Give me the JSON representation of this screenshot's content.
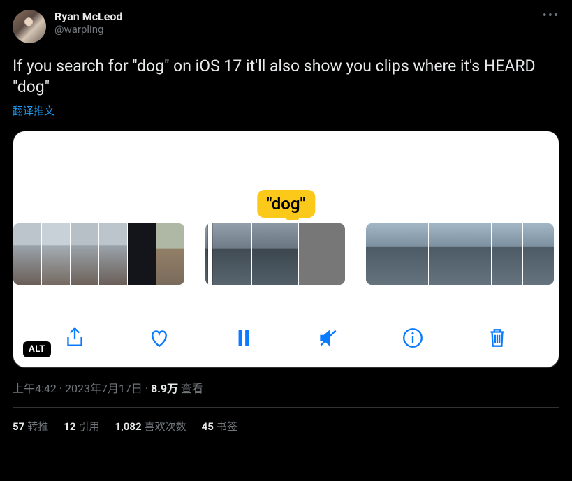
{
  "author": {
    "display_name": "Ryan McLeod",
    "handle": "@warpling"
  },
  "body": "If you search for \"dog\" on iOS 17 it'll also show you clips where it's HEARD \"dog\"",
  "translate_label": "翻译推文",
  "media": {
    "bubble": "\"dog\"",
    "alt_badge": "ALT"
  },
  "meta": {
    "time": "上午4:42",
    "sep1": " · ",
    "date": "2023年7月17日",
    "sep2": " · ",
    "views_num": "8.9万",
    "views_label": " 查看"
  },
  "stats": {
    "retweets_num": "57",
    "retweets_label": "转推",
    "quotes_num": "12",
    "quotes_label": "引用",
    "likes_num": "1,082",
    "likes_label": "喜欢次数",
    "bookmarks_num": "45",
    "bookmarks_label": "书签"
  }
}
